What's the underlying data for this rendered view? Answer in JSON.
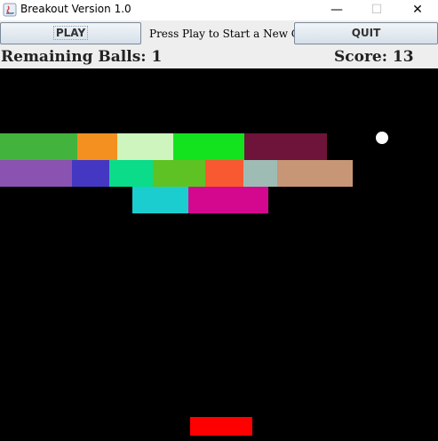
{
  "window": {
    "title": "Breakout Version 1.0",
    "controls": {
      "minimize": "—",
      "maximize": "☐",
      "close": "✕"
    }
  },
  "toolbar": {
    "play_label": "PLAY",
    "status_message": "Press Play to Start a New Game",
    "quit_label": "QUIT"
  },
  "hud": {
    "remaining_balls": "Remaining Balls: 1",
    "score": "Score: 13"
  },
  "game": {
    "background": "#000000",
    "ball_color": "#ffffff",
    "paddle_color": "#ff0000",
    "brick_rows": [
      [
        "#42b33d",
        "#f39020",
        "#cdf5bd",
        "#13e31f",
        "#6e1339"
      ],
      [
        "#8b53b1",
        "#4438c3",
        "#0bdc8a",
        "#5fc224",
        "#f95930",
        "#9fbcb4",
        "#c79677"
      ],
      [
        "#1ccdcf",
        "#d4078f"
      ]
    ]
  }
}
